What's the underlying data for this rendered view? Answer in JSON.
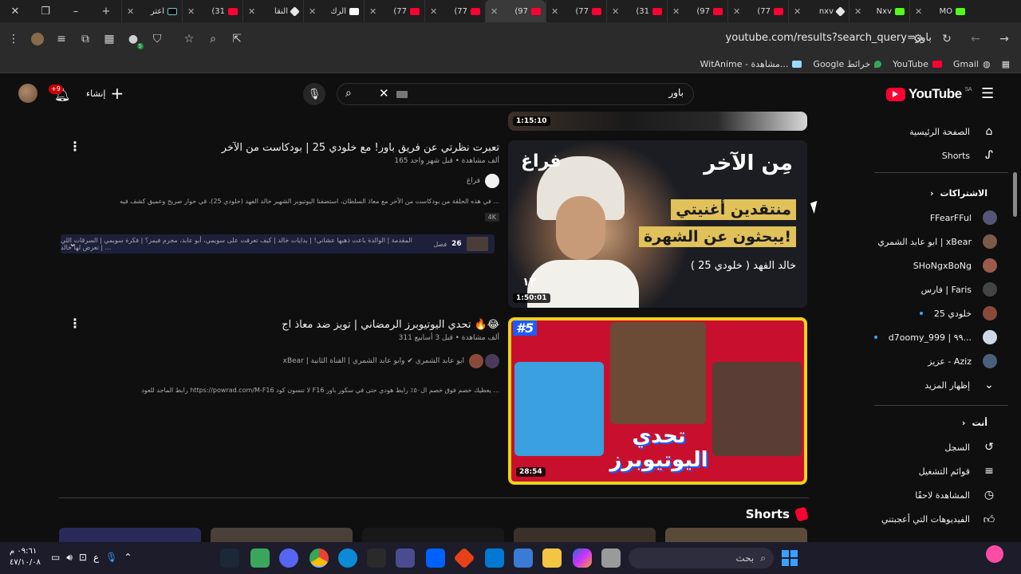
{
  "browser": {
    "tabs": [
      {
        "label": "MO",
        "favicon": "kick"
      },
      {
        "label": "Nxv",
        "favicon": "kick"
      },
      {
        "label": "nxv",
        "favicon": "gg"
      },
      {
        "label": "(77",
        "favicon": "youtube"
      },
      {
        "label": "(97",
        "favicon": "youtube"
      },
      {
        "label": "(31",
        "favicon": "youtube"
      },
      {
        "label": "(77",
        "favicon": "youtube"
      },
      {
        "label": "(97",
        "favicon": "youtube",
        "active": true
      },
      {
        "label": "(77",
        "favicon": "youtube"
      },
      {
        "label": "(77",
        "favicon": "youtube"
      },
      {
        "label": "الرك",
        "favicon": "x"
      },
      {
        "label": "النقا",
        "favicon": "gg"
      },
      {
        "label": "(31",
        "favicon": "youtube"
      },
      {
        "label": "اعتر",
        "favicon": "tiktok"
      }
    ],
    "url": "youtube.com/results?search_query=باور",
    "bookmarks": [
      {
        "label": "Gmail"
      },
      {
        "label": "YouTube"
      },
      {
        "label": "Google خرائط"
      },
      {
        "label": "WitAnime - مشاهدة..."
      }
    ],
    "extension_badge": "5"
  },
  "youtube": {
    "logo_text": "YouTube",
    "region": "SA",
    "search_query": "باور",
    "create_label": "إنشاء",
    "notif_count": "+9"
  },
  "sidebar": {
    "home": "الصفحة الرئيسية",
    "shorts": "Shorts",
    "subscriptions_heading": "الاشتراكات",
    "subscriptions": [
      {
        "name": "FFearFFul",
        "color": "#555577"
      },
      {
        "name": "ابو عابد الشمري | xBear",
        "color": "#7a5a48"
      },
      {
        "name": "SHoNgxBoNg",
        "color": "#9b5a4a"
      },
      {
        "name": "فارس | Faris",
        "color": "#444"
      },
      {
        "name": "خلودي 25",
        "color": "#8a4a3a",
        "live_dot": true
      },
      {
        "name": "d7oomy_999 | ٩٩...",
        "color": "#cfd8e6",
        "live_dot": true
      },
      {
        "name": "عزيز - Aziz",
        "color": "#4a5f7a"
      }
    ],
    "show_more": "إظهار المزيد",
    "you_heading": "أنت",
    "you_items": [
      {
        "label": "السجل",
        "icon": "history-icon"
      },
      {
        "label": "قوائم التشغيل",
        "icon": "playlists-icon"
      },
      {
        "label": "المشاهدة لاحقًا",
        "icon": "clock-icon"
      },
      {
        "label": "الفيديوهات التي أعجبتني",
        "icon": "thumbs-up-icon"
      }
    ]
  },
  "results": [
    {
      "duration": "1:15:10"
    },
    {
      "title": "تعبرت نظرتي عن فريق باور! مع خلودي 25 | بودكاست من الآخر",
      "views": "165 ألف مشاهدة",
      "age": "قبل شهر واحد",
      "channel": "فراغ",
      "description": "في هذه الحلقة من بودكاست من الآخر مع معاذ السلطان، استضفنا اليوتيوبر الشهير خالد الفهد (خلودي 25)، في حوار صريح وعميق كشف فيه ...",
      "badge": "4K",
      "duration": "1:50:01",
      "thumb_heading": "مِن الآخر",
      "thumb_corner": "فراغ",
      "thumb_line1": "منتقدين أغنيتي",
      "thumb_line2": "يبحثون عن الشهرة!",
      "thumb_guest": "خالد الفهد ( خلودي 25 )",
      "thumb_episode": "١٢",
      "chapters_count": "26",
      "chapters_label": "فصل",
      "chapters_text": "المقدمة | الوالدة باعت ذهبها عشاني! | بدايات خالد | كيف تعرفت على سويمي، أبو عابد، مجرم فيمز؟ | فكرة سويمي | السرقات اللي تعرض لها خالد | ..."
    },
    {
      "title": "تحدي اليوتيوبرز الرمضاني | تويز ضد معاذ اج 🔥😂",
      "views": "311 ألف مشاهدة",
      "age": "قبل 3 أسابيع",
      "channel_line": "xBear | ابو عابد الشمري ✔ وابو عابد الشمري | القناة الثانية",
      "description": "رابط الماجد للعود https://powrad.com/M-F16 لا تنسون كود F16 يعطيك خصم فوق خصم ال٥٠٪ رابط هودي حتى في سكور باور ...",
      "duration": "28:54",
      "thumb_badge": "#5",
      "thumb_title": "تحدي اليوتيوبرز"
    }
  ],
  "shorts_heading": "Shorts",
  "taskbar": {
    "search_placeholder": "بحث",
    "time": "٠٩:٦١ م",
    "date": "٤٧/١٠/٠٨",
    "lang": "ع"
  }
}
